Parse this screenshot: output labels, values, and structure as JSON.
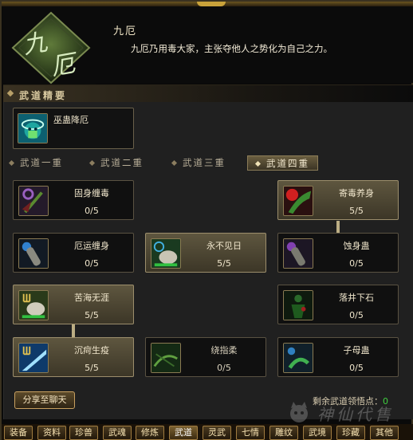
{
  "header": {
    "school_name": "九厄",
    "school_desc": "九厄乃用毒大家，主张夺他人之势化为自己之力。",
    "emblem_text": "九厄"
  },
  "section": {
    "title": "武道精要"
  },
  "essence_skill": {
    "name": "巫蛊降厄",
    "icon": "poison-skull-icon"
  },
  "tabs": [
    {
      "label": "武道一重",
      "active": false
    },
    {
      "label": "武道二重",
      "active": false
    },
    {
      "label": "武道三重",
      "active": false
    },
    {
      "label": "武道四重",
      "active": true
    }
  ],
  "skills": [
    {
      "name": "固身缠毒",
      "level": "0/5",
      "icon": "purple-staff-icon",
      "active": false
    },
    {
      "name": "寄毒养身",
      "level": "5/5",
      "icon": "red-poison-icon",
      "active": true
    },
    {
      "name": "厄运缠身",
      "level": "0/5",
      "icon": "blue-orb-icon",
      "active": false
    },
    {
      "name": "永不见日",
      "level": "5/5",
      "icon": "gourd-icon",
      "active": true
    },
    {
      "name": "蚀身蛊",
      "level": "0/5",
      "icon": "purple-gourd-icon",
      "active": false
    },
    {
      "name": "苦海无涯",
      "level": "5/5",
      "icon": "trident-gourd-icon",
      "active": true
    },
    {
      "name": "落井下石",
      "level": "0/5",
      "icon": "green-figure-icon",
      "active": false
    },
    {
      "name": "沉疴生疫",
      "level": "5/5",
      "icon": "trident-slash-icon",
      "active": true
    },
    {
      "name": "绕指柔",
      "level": "0/5",
      "icon": "green-whip-icon",
      "active": false
    },
    {
      "name": "子母蛊",
      "level": "0/5",
      "icon": "blue-worm-icon",
      "active": false
    }
  ],
  "footer": {
    "share_label": "分享至聊天",
    "remain_label": "剩余武道领悟点：",
    "remain_value": "0",
    "watermark": "神仙代售"
  },
  "bottom_tabs": [
    "装备",
    "资料",
    "珍兽",
    "武魂",
    "修炼",
    "武道",
    "灵武",
    "七情",
    "雕纹",
    "武境",
    "珍藏",
    "其他"
  ],
  "bottom_active": "武道",
  "colors": {
    "gold_border": "#9c8e6c",
    "active_card": "#5e563f",
    "points_green": "#40d040",
    "panel_bg": "#202020"
  }
}
